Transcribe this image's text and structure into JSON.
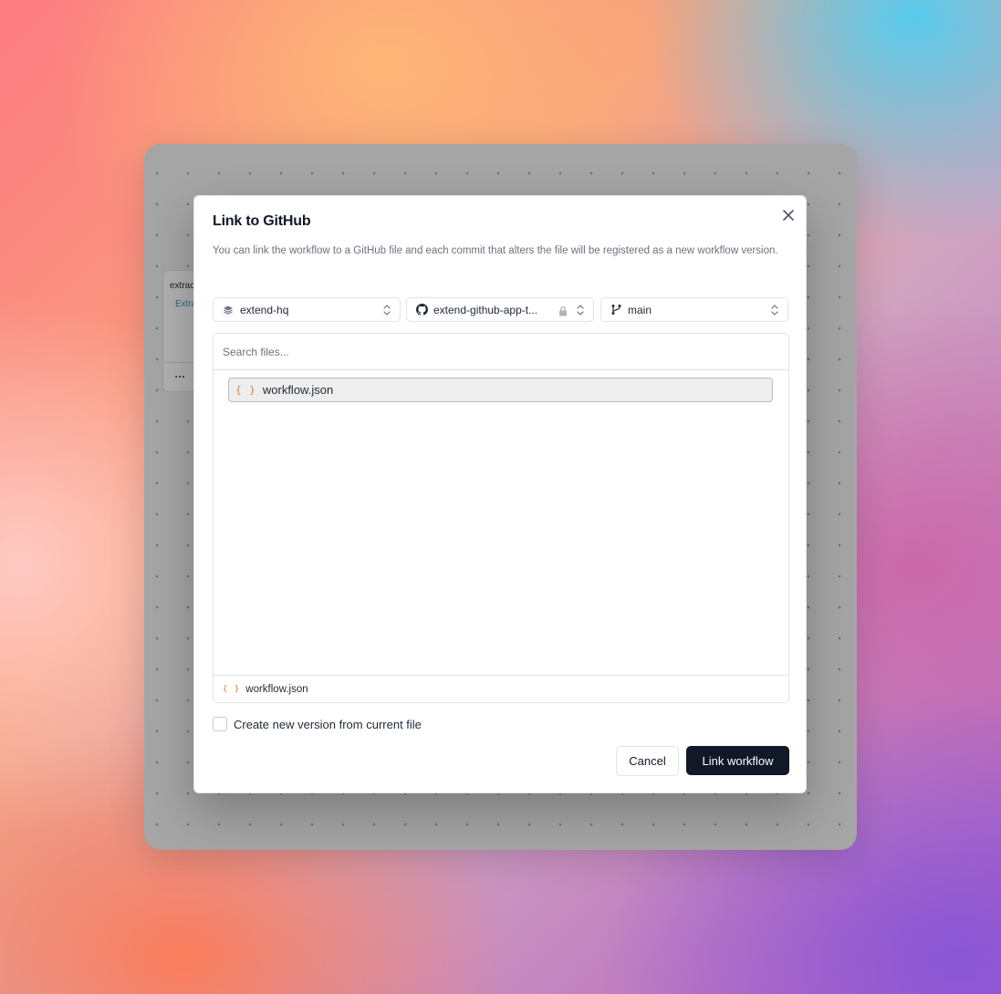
{
  "background_canvas": {
    "node": {
      "title": "extrac",
      "tag": "Extra",
      "menu": "…"
    }
  },
  "modal": {
    "title": "Link to GitHub",
    "description": "You can link the workflow to a GitHub file and each commit that alters the file will be registered as a new workflow version.",
    "selects": {
      "org": {
        "label": "extend-hq",
        "icon": "layers-icon"
      },
      "repo": {
        "label": "extend-github-app-t...",
        "icon": "github-icon",
        "private": true
      },
      "branch": {
        "label": "main",
        "icon": "git-branch-icon"
      }
    },
    "search": {
      "placeholder": "Search files...",
      "value": ""
    },
    "files": [
      {
        "name": "workflow.json",
        "icon": "{ }",
        "selected": true
      }
    ],
    "selected_file": {
      "name": "workflow.json",
      "icon": "{ }"
    },
    "checkbox": {
      "label": "Create new version from current file",
      "checked": false
    },
    "buttons": {
      "cancel": "Cancel",
      "submit": "Link workflow"
    }
  },
  "colors": {
    "primary_button": "#111827",
    "json_icon": "#e07a2b",
    "border": "#e1e3e7",
    "muted_text": "#6b7280"
  }
}
